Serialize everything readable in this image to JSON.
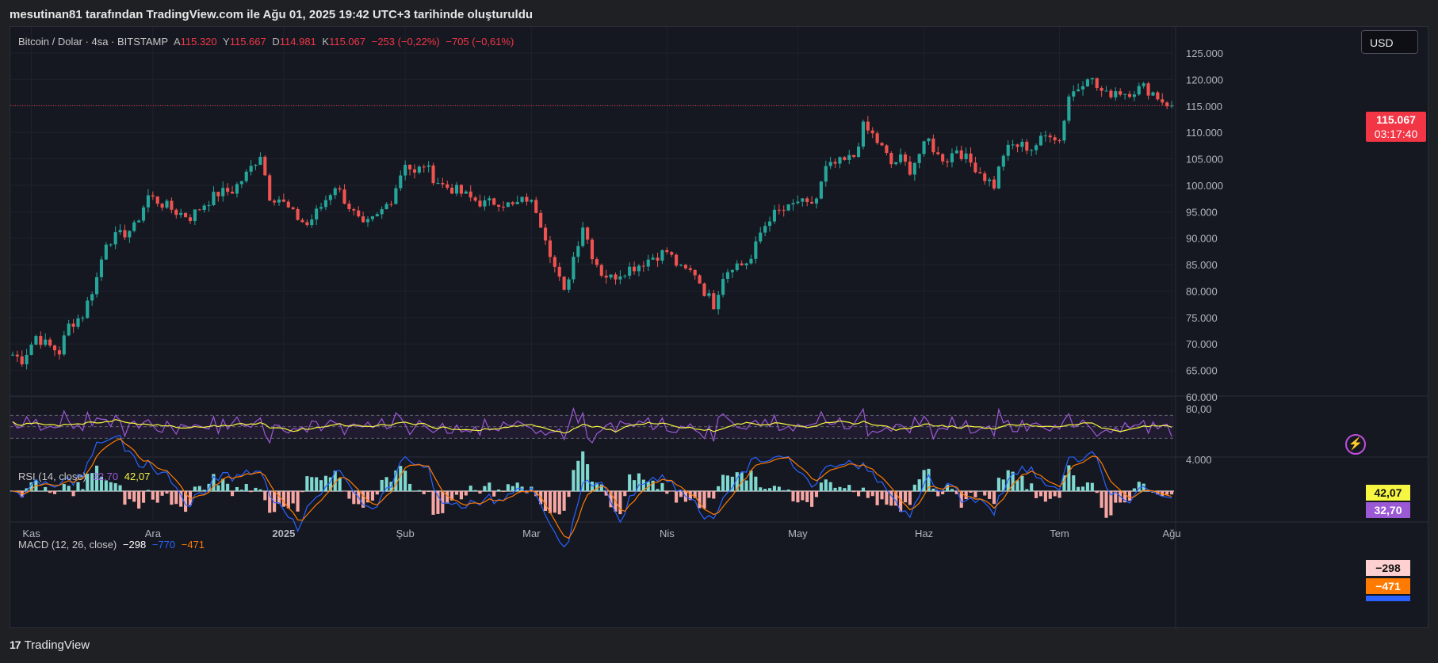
{
  "header": {
    "text": "mesutinan81 tarafından TradingView.com ile Ağu 01, 2025 19:42 UTC+3 tarihinde oluşturuldu"
  },
  "legend": {
    "symbol": "Bitcoin / Dolar · 4sa · BITSTAMP",
    "o_label": "A",
    "o_value": "115.320",
    "h_label": "Y",
    "h_value": "115.667",
    "l_label": "D",
    "l_value": "114.981",
    "c_label": "K",
    "c_value": "115.067",
    "change": "−253 (−0,22%)",
    "change2": "−705 (−0,61%)"
  },
  "currency_button": "USD",
  "price_tag": {
    "price": "115.067",
    "countdown": "03:17:40"
  },
  "rsi": {
    "label": "RSI (14, close)",
    "value1": "32,70",
    "value2": "42,07",
    "upper_tick": "80,00"
  },
  "macd": {
    "label": "MACD (12, 26, close)",
    "hist": "−298",
    "macd": "−770",
    "signal": "−471",
    "top_tick": "4.000"
  },
  "footer": {
    "logo_mark": "17",
    "brand": "TradingView"
  },
  "colors": {
    "up": "#26a69a",
    "down": "#ef5350",
    "rsi": "#9b59d6",
    "rsi_ma": "#f5f542",
    "macd": "#2962ff",
    "signal": "#ff7a00"
  },
  "chart_data": {
    "type": "candlestick",
    "title": "Bitcoin / Dolar · 4sa · BITSTAMP",
    "y_ticks": [
      "125.000",
      "120.000",
      "115.000",
      "110.000",
      "105.000",
      "100.000",
      "95.000",
      "90.000",
      "85.000",
      "80.000",
      "75.000",
      "70.000",
      "65.000",
      "60.000"
    ],
    "ylim": [
      60000,
      125000
    ],
    "x_ticks": [
      "Kas",
      "Ara",
      "2025",
      "Şub",
      "Mar",
      "Nis",
      "May",
      "Haz",
      "Tem",
      "Ağu"
    ],
    "close_path": [
      [
        0,
        68000
      ],
      [
        2,
        67000
      ],
      [
        5,
        71500
      ],
      [
        7,
        70000
      ],
      [
        10,
        68500
      ],
      [
        12,
        73500
      ],
      [
        15,
        75500
      ],
      [
        18,
        82500
      ],
      [
        20,
        89500
      ],
      [
        23,
        90500
      ],
      [
        26,
        92000
      ],
      [
        29,
        98000
      ],
      [
        32,
        96500
      ],
      [
        35,
        95000
      ],
      [
        38,
        94000
      ],
      [
        41,
        96500
      ],
      [
        44,
        98500
      ],
      [
        47,
        99000
      ],
      [
        50,
        102000
      ],
      [
        53,
        106000
      ],
      [
        55,
        98000
      ],
      [
        57,
        97500
      ],
      [
        60,
        94500
      ],
      [
        63,
        92500
      ],
      [
        66,
        96000
      ],
      [
        69,
        100000
      ],
      [
        72,
        96000
      ],
      [
        75,
        92000
      ],
      [
        78,
        94000
      ],
      [
        81,
        97500
      ],
      [
        84,
        104500
      ],
      [
        86,
        102000
      ],
      [
        88,
        104000
      ],
      [
        90,
        101500
      ],
      [
        92,
        100000
      ],
      [
        95,
        99000
      ],
      [
        98,
        97500
      ],
      [
        101,
        96500
      ],
      [
        104,
        97000
      ],
      [
        107,
        96000
      ],
      [
        110,
        97500
      ],
      [
        112,
        95500
      ],
      [
        114,
        90500
      ],
      [
        116,
        84500
      ],
      [
        118,
        79500
      ],
      [
        120,
        86500
      ],
      [
        122,
        92500
      ],
      [
        124,
        87000
      ],
      [
        126,
        83500
      ],
      [
        128,
        82500
      ],
      [
        131,
        84000
      ],
      [
        134,
        85000
      ],
      [
        137,
        86500
      ],
      [
        140,
        87500
      ],
      [
        143,
        84000
      ],
      [
        146,
        83500
      ],
      [
        148,
        80000
      ],
      [
        150,
        77500
      ],
      [
        152,
        83000
      ],
      [
        154,
        85000
      ],
      [
        156,
        85000
      ],
      [
        158,
        86000
      ],
      [
        160,
        91000
      ],
      [
        162,
        94000
      ],
      [
        164,
        95000
      ],
      [
        166,
        95500
      ],
      [
        168,
        97000
      ],
      [
        170,
        96000
      ],
      [
        172,
        97500
      ],
      [
        174,
        103000
      ],
      [
        176,
        104000
      ],
      [
        178,
        104500
      ],
      [
        180,
        105500
      ],
      [
        182,
        111000
      ],
      [
        184,
        109500
      ],
      [
        186,
        107000
      ],
      [
        188,
        104000
      ],
      [
        190,
        105000
      ],
      [
        192,
        103000
      ],
      [
        194,
        106000
      ],
      [
        196,
        108500
      ],
      [
        198,
        105500
      ],
      [
        200,
        105000
      ],
      [
        202,
        107000
      ],
      [
        204,
        105000
      ],
      [
        206,
        103500
      ],
      [
        208,
        101500
      ],
      [
        210,
        100000
      ],
      [
        212,
        106000
      ],
      [
        214,
        107500
      ],
      [
        216,
        107500
      ],
      [
        218,
        107000
      ],
      [
        220,
        108500
      ],
      [
        222,
        110000
      ],
      [
        224,
        108500
      ],
      [
        226,
        117000
      ],
      [
        228,
        118500
      ],
      [
        230,
        121000
      ],
      [
        232,
        118500
      ],
      [
        234,
        117000
      ],
      [
        236,
        118000
      ],
      [
        238,
        117500
      ],
      [
        240,
        118000
      ],
      [
        242,
        118500
      ],
      [
        244,
        117500
      ],
      [
        246,
        116000
      ],
      [
        248,
        115067
      ]
    ],
    "x_tick_index": [
      4,
      30,
      58,
      84,
      111,
      140,
      168,
      195,
      224,
      248
    ],
    "last_price": 115067,
    "rsi_ylim": [
      0,
      100
    ],
    "rsi_bands": [
      70,
      50,
      30
    ],
    "macd_last": {
      "hist": -298,
      "macd": -770,
      "signal": -471
    }
  }
}
